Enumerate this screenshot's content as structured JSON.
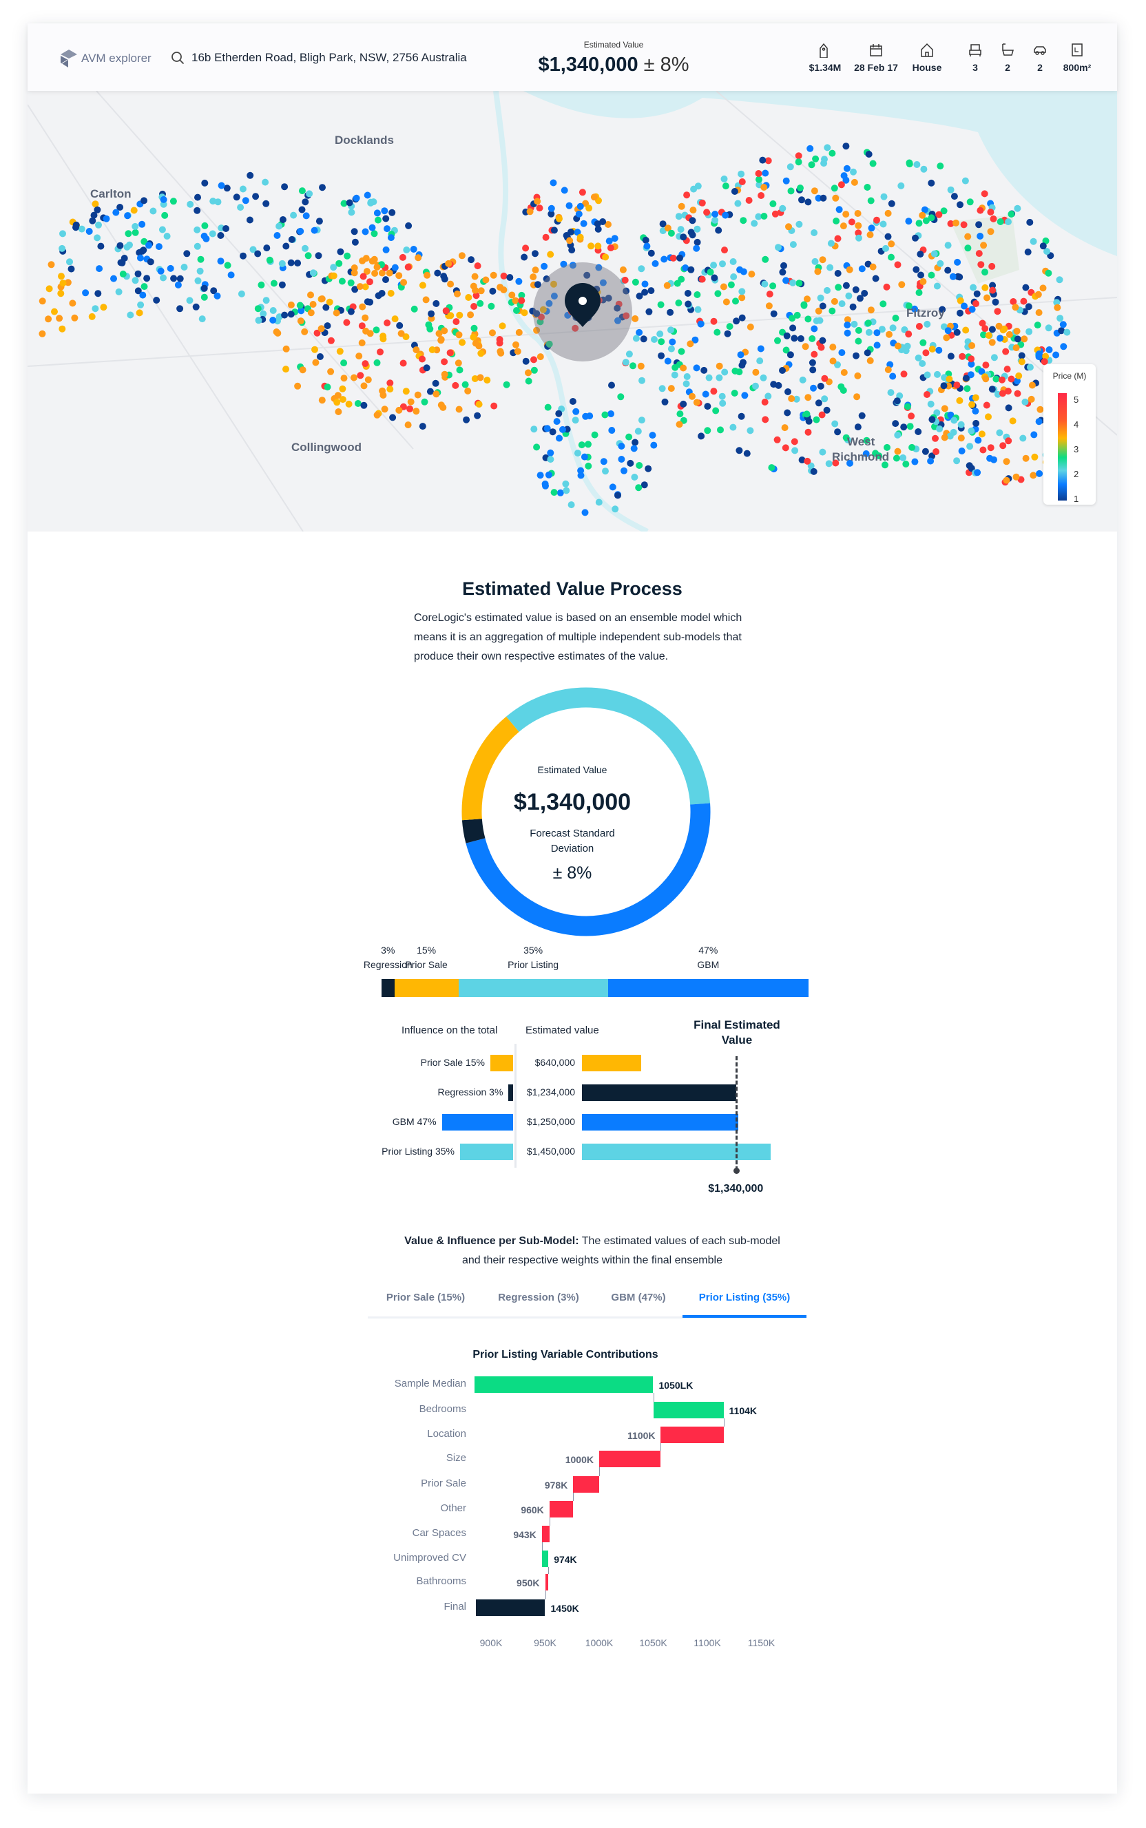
{
  "header": {
    "logo_text": "AVM explorer",
    "address": "16b Etherden Road, Bligh Park, NSW, 2756 Australia",
    "estimated_value_label": "Estimated Value",
    "estimated_value": "$1,340,000",
    "deviation": "± 8%",
    "stats": [
      {
        "icon": "price-tag-icon",
        "value": "$1.34M"
      },
      {
        "icon": "calendar-icon",
        "value": "28 Feb 17"
      },
      {
        "icon": "house-icon",
        "value": "House"
      },
      {
        "icon": "bed-icon",
        "value": "3"
      },
      {
        "icon": "bath-icon",
        "value": "2"
      },
      {
        "icon": "car-icon",
        "value": "2"
      },
      {
        "icon": "land-area-icon",
        "value": "800m²"
      }
    ]
  },
  "map": {
    "labels": [
      "Docklands",
      "Carlton",
      "Collingwood",
      "Fitzroy",
      "West",
      "Richmond"
    ],
    "legend": {
      "title": "Price (M)",
      "ticks": [
        "5",
        "4",
        "3",
        "2",
        "1"
      ]
    }
  },
  "process": {
    "title": "Estimated Value Process",
    "intro": "CoreLogic's estimated value is based on an ensemble model which means it is an aggregation of multiple independent sub-models that produce their own respective estimates of the value.",
    "donut_label": "Estimated Value",
    "donut_value": "$1,340,000",
    "donut_sub1": "Forecast Standard",
    "donut_sub2": "Deviation",
    "donut_dev": "± 8%"
  },
  "influence": {
    "col1": "Influence on the total",
    "col2": "Estimated value",
    "final_label_1": "Final Estimated",
    "final_label_2": "Value",
    "final_value": "$1,340,000",
    "final_numeric": 1340000
  },
  "submodel_text": {
    "bold": "Value & Influence per Sub-Model:",
    "rest": " The estimated values of each sub-model and their respective weights within the final ensemble"
  },
  "tabs": [
    {
      "label": "Prior Sale (15%)",
      "active": false
    },
    {
      "label": "Regression (3%)",
      "active": false
    },
    {
      "label": "GBM (47%)",
      "active": false
    },
    {
      "label": "Prior Listing (35%)",
      "active": true
    }
  ],
  "colors": {
    "regression": "#0b2034",
    "prior_sale": "#ffb703",
    "prior_listing": "#5dd3e4",
    "gbm": "#0a7cff",
    "positive": "#0bdc84",
    "negative": "#ff2a47",
    "final": "#0b2034"
  },
  "chart_data": [
    {
      "type": "pie",
      "title": "Ensemble weights",
      "donut_order": [
        "Prior Listing",
        "GBM",
        "Regression",
        "Prior Sale"
      ],
      "stack_order": [
        "Regression",
        "Prior Sale",
        "Prior Listing",
        "GBM"
      ],
      "models": [
        {
          "key": "regression",
          "name": "Regression",
          "weight": 3,
          "weight_label": "3%",
          "influence_label": "Regression 3%",
          "value": 1234000,
          "value_label": "$1,234,000"
        },
        {
          "key": "prior_sale",
          "name": "Prior Sale",
          "weight": 15,
          "weight_label": "15%",
          "influence_label": "Prior Sale 15%",
          "value": 640000,
          "value_label": "$640,000"
        },
        {
          "key": "prior_listing",
          "name": "Prior Listing",
          "weight": 35,
          "weight_label": "35%",
          "influence_label": "Prior Listing 35%",
          "value": 1450000,
          "value_label": "$1,450,000"
        },
        {
          "key": "gbm",
          "name": "GBM",
          "weight": 47,
          "weight_label": "47%",
          "influence_label": "GBM 47%",
          "value": 1250000,
          "value_label": "$1,250,000"
        }
      ],
      "influence_row_order": [
        "prior_sale",
        "regression",
        "gbm",
        "prior_listing"
      ]
    },
    {
      "type": "bar",
      "subtype": "waterfall",
      "title": "Prior Listing Variable Contributions",
      "x_unit": "K",
      "xlim": [
        900,
        1150
      ],
      "xticks": [
        "900K",
        "950K",
        "1000K",
        "1050K",
        "1100K",
        "1150K"
      ],
      "xtick_values": [
        900,
        950,
        1000,
        1050,
        1100,
        1150
      ],
      "bars": [
        {
          "category": "Sample Median",
          "start": 885,
          "end": 1050,
          "kind": "positive",
          "label": "1050LK"
        },
        {
          "category": "Bedrooms",
          "start": 1050,
          "end": 1115,
          "kind": "positive",
          "label": "1104K"
        },
        {
          "category": "Location",
          "start": 1057,
          "end": 1115,
          "kind": "negative",
          "label": "1100K"
        },
        {
          "category": "Size",
          "start": 1000,
          "end": 1057,
          "kind": "negative",
          "label": "1000K"
        },
        {
          "category": "Prior Sale",
          "start": 976,
          "end": 1000,
          "kind": "negative",
          "label": "978K"
        },
        {
          "category": "Other",
          "start": 954,
          "end": 976,
          "kind": "negative",
          "label": "960K"
        },
        {
          "category": "Car Spaces",
          "start": 947,
          "end": 954,
          "kind": "negative",
          "label": "943K"
        },
        {
          "category": "Unimproved CV",
          "start": 947,
          "end": 953,
          "kind": "positive",
          "label": "974K"
        },
        {
          "category": "Bathrooms",
          "start": 950,
          "end": 953,
          "kind": "negative",
          "label": "950K"
        },
        {
          "category": "Final",
          "start": 886,
          "end": 950,
          "kind": "final",
          "label": "1450K"
        }
      ]
    }
  ]
}
